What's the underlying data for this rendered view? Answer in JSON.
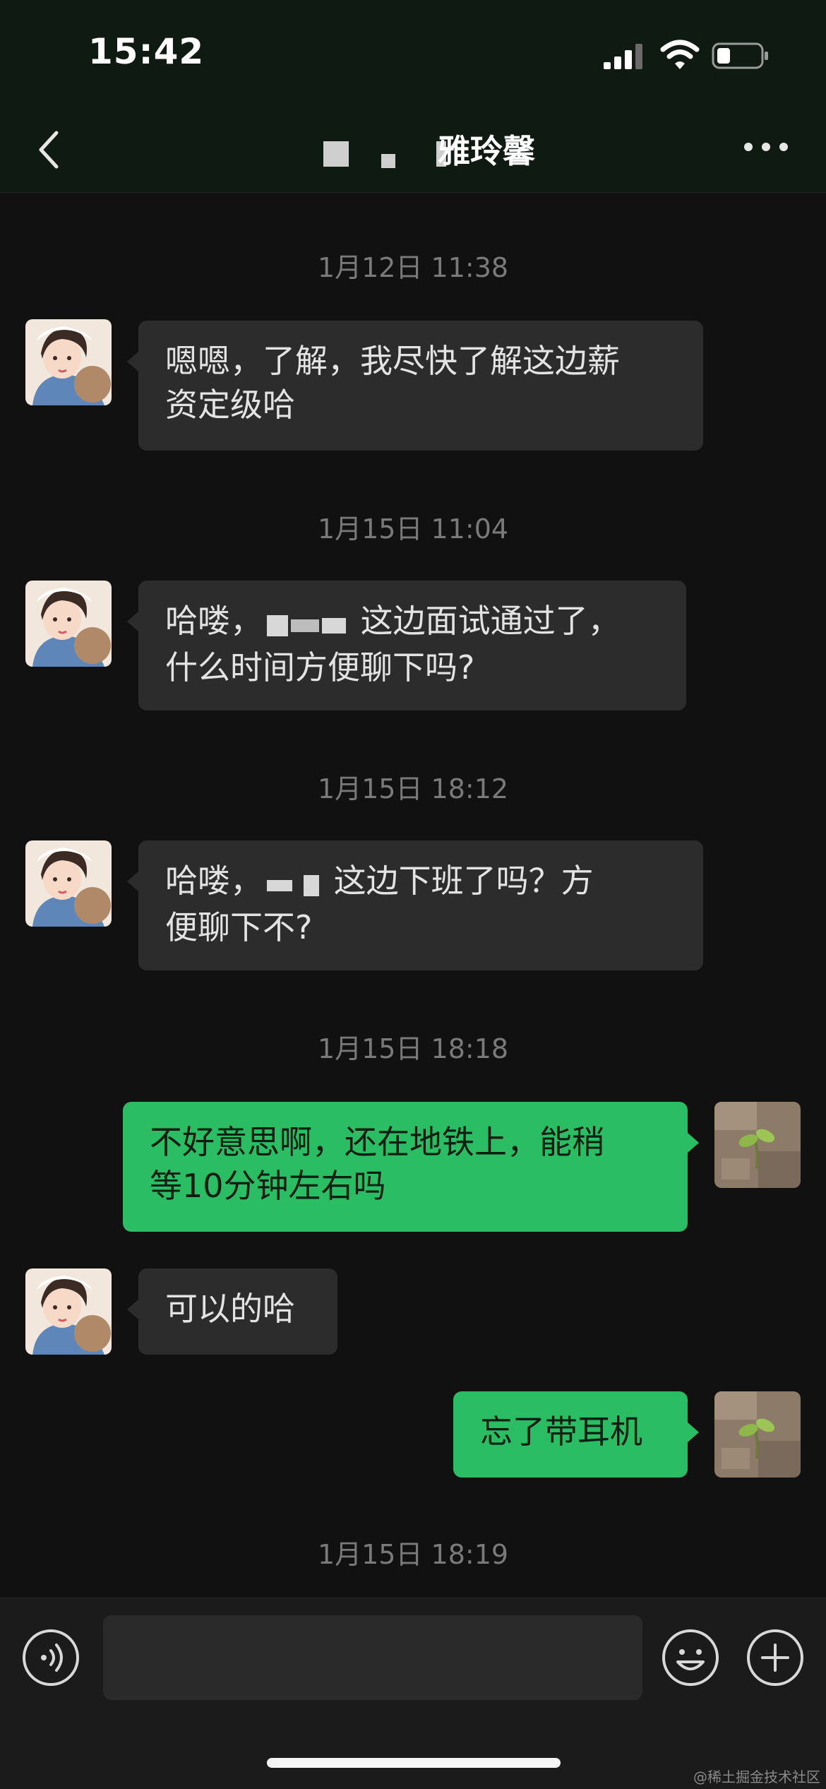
{
  "status_bar": {
    "time": "15:42",
    "icons": [
      "signal-icon",
      "wifi-icon",
      "battery-icon"
    ],
    "battery_level": 0.3
  },
  "header": {
    "title": "雅玲馨",
    "back_icon": "chevron-left-icon",
    "more_icon": "more-dots-icon"
  },
  "messages": [
    {
      "type": "timestamp",
      "text": "1月12日 11:38"
    },
    {
      "type": "incoming",
      "line1": "嗯嗯，了解，我尽快了解这边薪",
      "line2": "资定级哈"
    },
    {
      "type": "timestamp",
      "text": "1月15日 11:04"
    },
    {
      "type": "incoming",
      "pre": "哈喽，",
      "post": "这边面试通过了，",
      "line2": "什么时间方便聊下吗?"
    },
    {
      "type": "timestamp",
      "text": "1月15日 18:12"
    },
    {
      "type": "incoming",
      "pre": "哈喽，",
      "post": "这边下班了吗？方",
      "line2": "便聊下不?"
    },
    {
      "type": "timestamp",
      "text": "1月15日 18:18"
    },
    {
      "type": "outgoing",
      "line1": "不好意思啊，还在地铁上，能稍",
      "line2": "等10分钟左右吗"
    },
    {
      "type": "incoming",
      "text": "可以的哈"
    },
    {
      "type": "outgoing",
      "text": "忘了带耳机"
    },
    {
      "type": "timestamp",
      "text": "1月15日 18:19"
    }
  ],
  "input_bar": {
    "placeholder": "",
    "icons": [
      "voice-icon",
      "emoji-icon",
      "plus-icon"
    ]
  },
  "watermark": "@稀土掘金技术社区",
  "colors": {
    "outgoing_bubble": "#2bbd63",
    "incoming_bubble": "#2c2c2c",
    "background": "#111111"
  }
}
